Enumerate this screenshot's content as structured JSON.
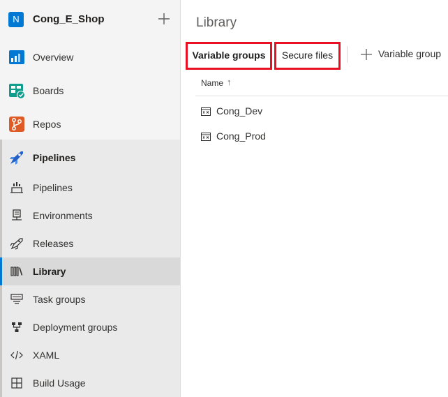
{
  "project": {
    "initial": "N",
    "name": "Cong_E_Shop",
    "add_icon": "plus-icon"
  },
  "sidebar": {
    "top_items": [
      {
        "label": "Overview",
        "icon": "overview-icon"
      },
      {
        "label": "Boards",
        "icon": "boards-icon"
      },
      {
        "label": "Repos",
        "icon": "repos-icon"
      }
    ],
    "group": {
      "label": "Pipelines",
      "icon": "pipelines-rocket-icon",
      "items": [
        {
          "label": "Pipelines",
          "icon": "pipelines-icon"
        },
        {
          "label": "Environments",
          "icon": "environments-icon"
        },
        {
          "label": "Releases",
          "icon": "releases-rocket-icon"
        },
        {
          "label": "Library",
          "icon": "library-icon",
          "selected": true
        },
        {
          "label": "Task groups",
          "icon": "task-groups-icon"
        },
        {
          "label": "Deployment groups",
          "icon": "deployment-groups-icon"
        },
        {
          "label": "XAML",
          "icon": "code-icon"
        },
        {
          "label": "Build Usage",
          "icon": "grid-icon"
        }
      ]
    }
  },
  "main": {
    "title": "Library",
    "tabs": [
      {
        "label": "Variable groups",
        "selected": true
      },
      {
        "label": "Secure files",
        "selected": false
      }
    ],
    "toolbar": {
      "add_label": "Variable group",
      "add_icon": "plus-icon"
    },
    "list": {
      "column": "Name",
      "sort": "↑",
      "rows": [
        {
          "name": "Cong_Dev",
          "icon": "variable-group-icon"
        },
        {
          "name": "Cong_Prod",
          "icon": "variable-group-icon"
        }
      ]
    }
  },
  "colors": {
    "accent": "#0078d4",
    "highlight_border": "#e81123"
  }
}
